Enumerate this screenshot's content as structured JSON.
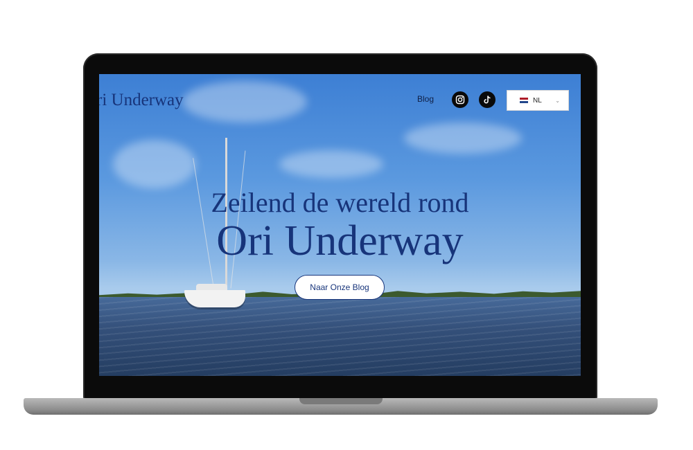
{
  "site": {
    "logo_text": "ri Underway"
  },
  "nav": {
    "blog_label": "Blog",
    "social": [
      {
        "icon": "instagram-icon"
      },
      {
        "icon": "tiktok-icon"
      }
    ],
    "language": {
      "selected": "NL",
      "flag_colors": [
        "#ae1c28",
        "#ffffff",
        "#21468b"
      ]
    }
  },
  "hero": {
    "subtitle": "Zeilend de wereld rond",
    "title": "Ori Underway",
    "cta_label": "Naar Onze Blog"
  },
  "colors": {
    "brand_navy": "#17347a",
    "sky": "#5b99df",
    "water": "#34507a"
  }
}
